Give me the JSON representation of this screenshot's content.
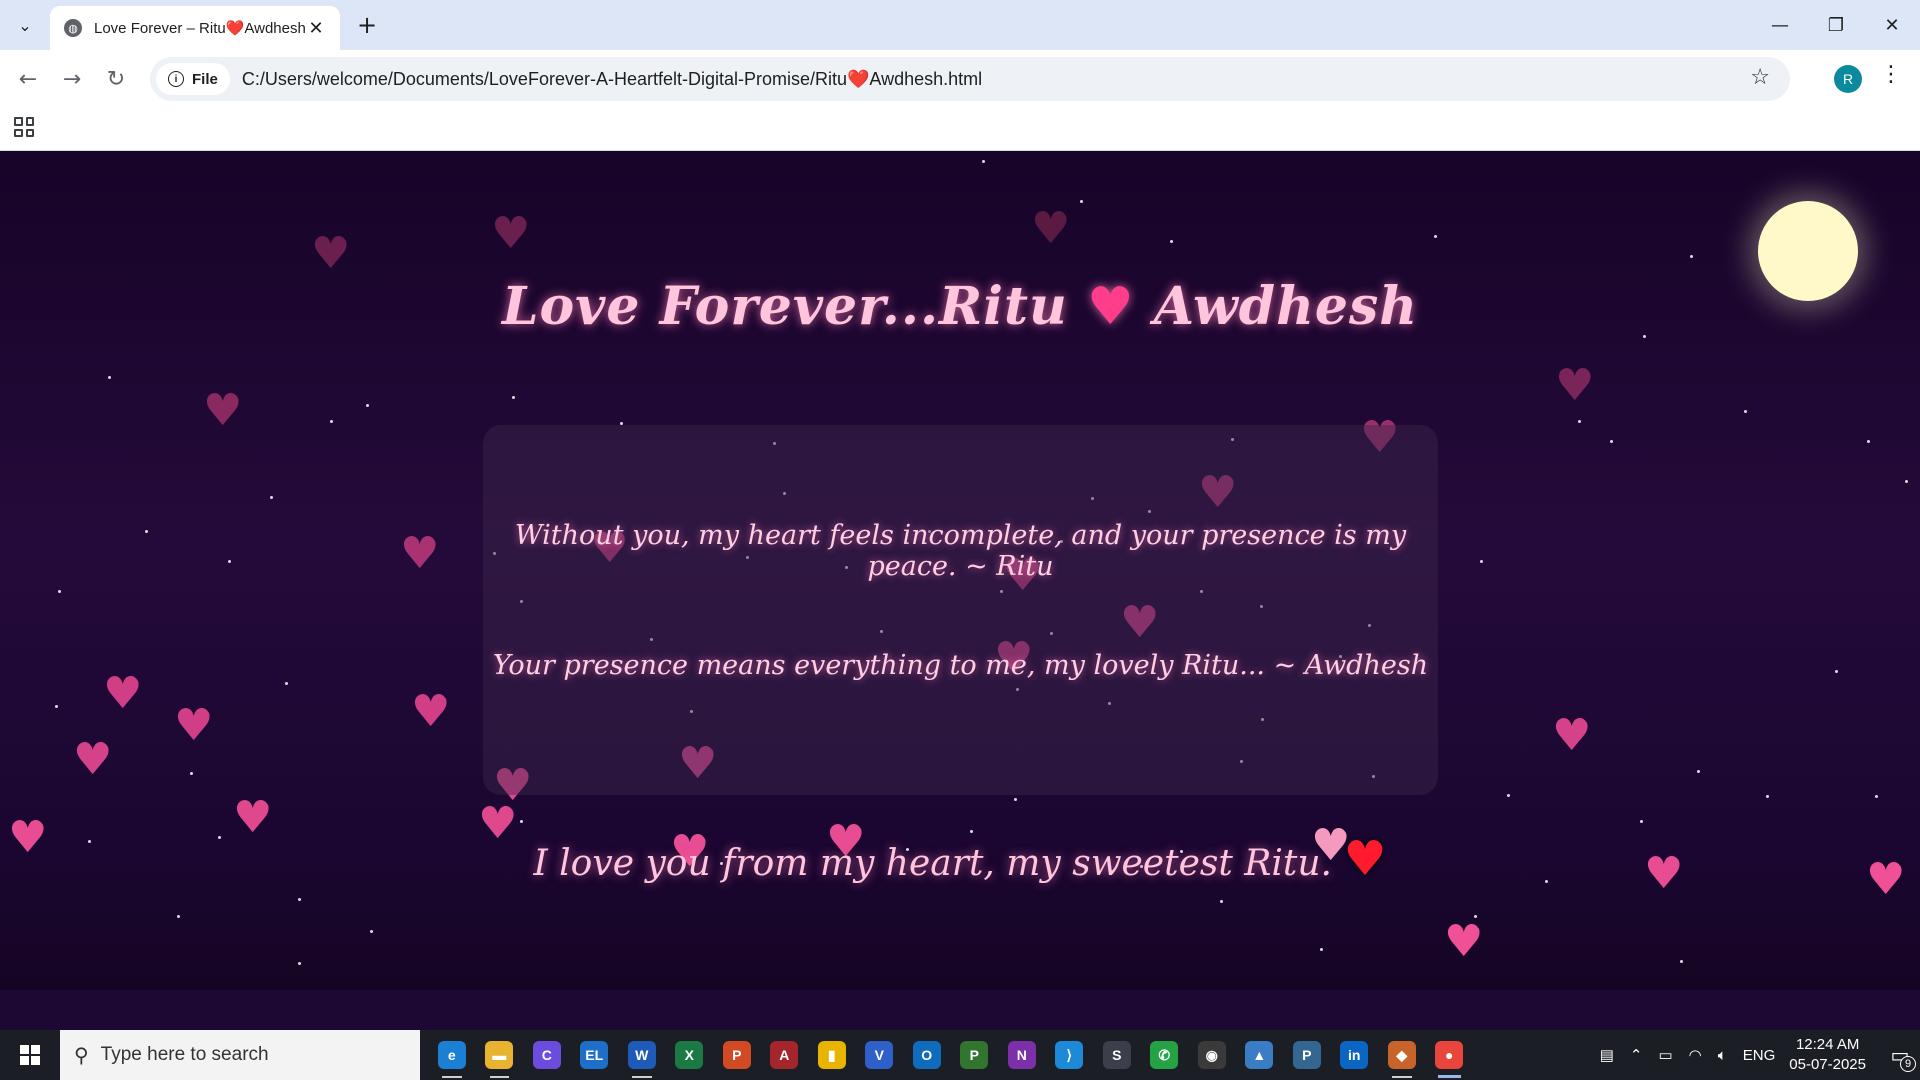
{
  "browser": {
    "tab_title": "Love Forever – Ritu❤️Awdhesh",
    "new_tab_label": "+",
    "file_chip_label": "File",
    "url": "C:/Users/welcome/Documents/LoveForever-A-Heartfelt-Digital-Promise/Ritu❤️Awdhesh.html",
    "profile_initial": "R"
  },
  "page": {
    "title_part1": "Love Forever...Ritu",
    "title_heart": "♥",
    "title_part2": "Awdhesh",
    "message_1": "Without you, my heart feels incomplete, and your presence is my peace. ~ Ritu",
    "message_2": "Your presence means everything to me, my lovely Ritu... ~ Awdhesh",
    "closing_text": "I love you from my heart, my sweetest Ritu.",
    "closing_heart": "♥"
  },
  "taskbar": {
    "search_placeholder": "Type here to search",
    "apps": [
      {
        "name": "edge",
        "label": "e",
        "color": "#1b7fd4"
      },
      {
        "name": "file-explorer",
        "label": "▬",
        "color": "#e8b331"
      },
      {
        "name": "canva",
        "label": "C",
        "color": "#6c4cde"
      },
      {
        "name": "el-app",
        "label": "EL",
        "color": "#1e6fc8"
      },
      {
        "name": "word",
        "label": "W",
        "color": "#1e5bb8"
      },
      {
        "name": "excel",
        "label": "X",
        "color": "#1b7a43"
      },
      {
        "name": "powerpoint",
        "label": "P",
        "color": "#d14a24"
      },
      {
        "name": "access",
        "label": "A",
        "color": "#a4262c"
      },
      {
        "name": "power-bi",
        "label": "▮",
        "color": "#e8b400"
      },
      {
        "name": "visio",
        "label": "V",
        "color": "#2f5fc8"
      },
      {
        "name": "outlook",
        "label": "O",
        "color": "#0f6cbd"
      },
      {
        "name": "project",
        "label": "P",
        "color": "#31752f"
      },
      {
        "name": "onenote",
        "label": "N",
        "color": "#7b2fa8"
      },
      {
        "name": "vscode",
        "label": "⟩",
        "color": "#1c8ad6"
      },
      {
        "name": "sublime-app",
        "label": "S",
        "color": "#3a3f4b"
      },
      {
        "name": "whatsapp",
        "label": "✆",
        "color": "#25a244"
      },
      {
        "name": "obs",
        "label": "◉",
        "color": "#3a3a3a"
      },
      {
        "name": "app-tools",
        "label": "▲",
        "color": "#3b7dc4"
      },
      {
        "name": "postgres",
        "label": "P",
        "color": "#336791"
      },
      {
        "name": "linkedin",
        "label": "in",
        "color": "#0a66c2"
      },
      {
        "name": "git-app",
        "label": "◆",
        "color": "#c8632b"
      },
      {
        "name": "chrome",
        "label": "●",
        "color": "#e8453c"
      }
    ],
    "language": "ENG",
    "time": "12:24 AM",
    "date": "05-07-2025",
    "notification_count": "9"
  }
}
